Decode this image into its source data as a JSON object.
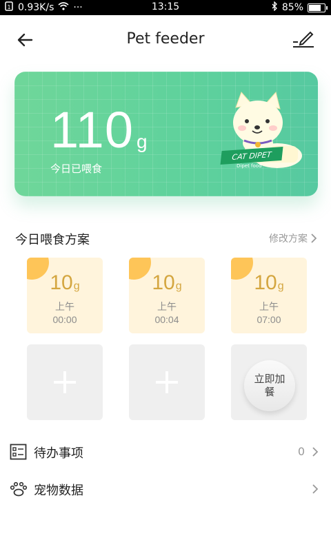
{
  "status_bar": {
    "speed": "0.93K/s",
    "dots": "···",
    "time": "13:15",
    "battery": "85%",
    "battery_level": 0.85
  },
  "header": {
    "title": "Pet feeder",
    "back_icon": "arrow-left-icon",
    "edit_icon": "pen-edit-icon"
  },
  "card": {
    "amount": "110",
    "unit": "g",
    "label": "今日已喂食",
    "brand": "CAT DIPET",
    "brand_sub": "Dipet food",
    "colors": {
      "start": "#6fd69a",
      "end": "#56c9a0"
    }
  },
  "plan": {
    "title": "今日喂食方案",
    "edit_link": "修改方案",
    "meals": [
      {
        "amount": "10",
        "unit": "g",
        "period": "上午",
        "time": "00:00"
      },
      {
        "amount": "10",
        "unit": "g",
        "period": "上午",
        "time": "00:04"
      },
      {
        "amount": "10",
        "unit": "g",
        "period": "上午",
        "time": "07:00"
      }
    ],
    "feed_now": "立即加餐",
    "accent": "#fec558"
  },
  "list": [
    {
      "label": "待办事项",
      "count": "0",
      "icon": "checklist-icon"
    },
    {
      "label": "宠物数据",
      "count": "",
      "icon": "paw-icon"
    }
  ]
}
